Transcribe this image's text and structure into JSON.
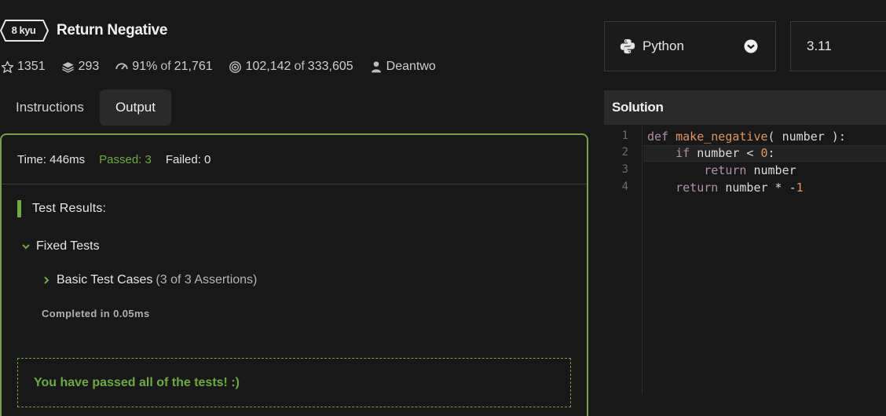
{
  "kata": {
    "rank": "8 kyu",
    "title": "Return Negative"
  },
  "stats": {
    "stars": "1351",
    "collections": "293",
    "satisfaction_pct": "91%",
    "satisfaction_of": "of",
    "satisfaction_total": "21,761",
    "completions": "102,142",
    "completions_of": "of",
    "attempts_total": "333,605",
    "author": "Deantwo"
  },
  "tabs": [
    {
      "label": "Instructions",
      "active": false
    },
    {
      "label": "Output",
      "active": true
    }
  ],
  "output": {
    "time": "Time: 446ms",
    "passed": "Passed: 3",
    "failed": "Failed: 0",
    "results_heading": "Test Results:",
    "group_label": "Fixed Tests",
    "subgroup_label": "Basic Test Cases",
    "subgroup_assertions": "(3 of 3 Assertions)",
    "completed": "Completed in 0.05ms",
    "success_message": "You have passed all of the tests! :)"
  },
  "editor": {
    "language": "Python",
    "version": "3.11",
    "panel_title": "Solution",
    "line_numbers": [
      "1",
      "2",
      "3",
      "4"
    ]
  },
  "icons": {
    "star": "star-icon",
    "collections": "layers-icon",
    "satisfaction": "gauge-icon",
    "completions": "target-icon",
    "author": "user-icon",
    "language": "python-icon",
    "dropdown": "chevron-down-circle-icon"
  },
  "colors": {
    "accent_green": "#6cac3d",
    "output_border": "#73a23f",
    "background": "#181818",
    "panel": "#2a2a2a"
  }
}
